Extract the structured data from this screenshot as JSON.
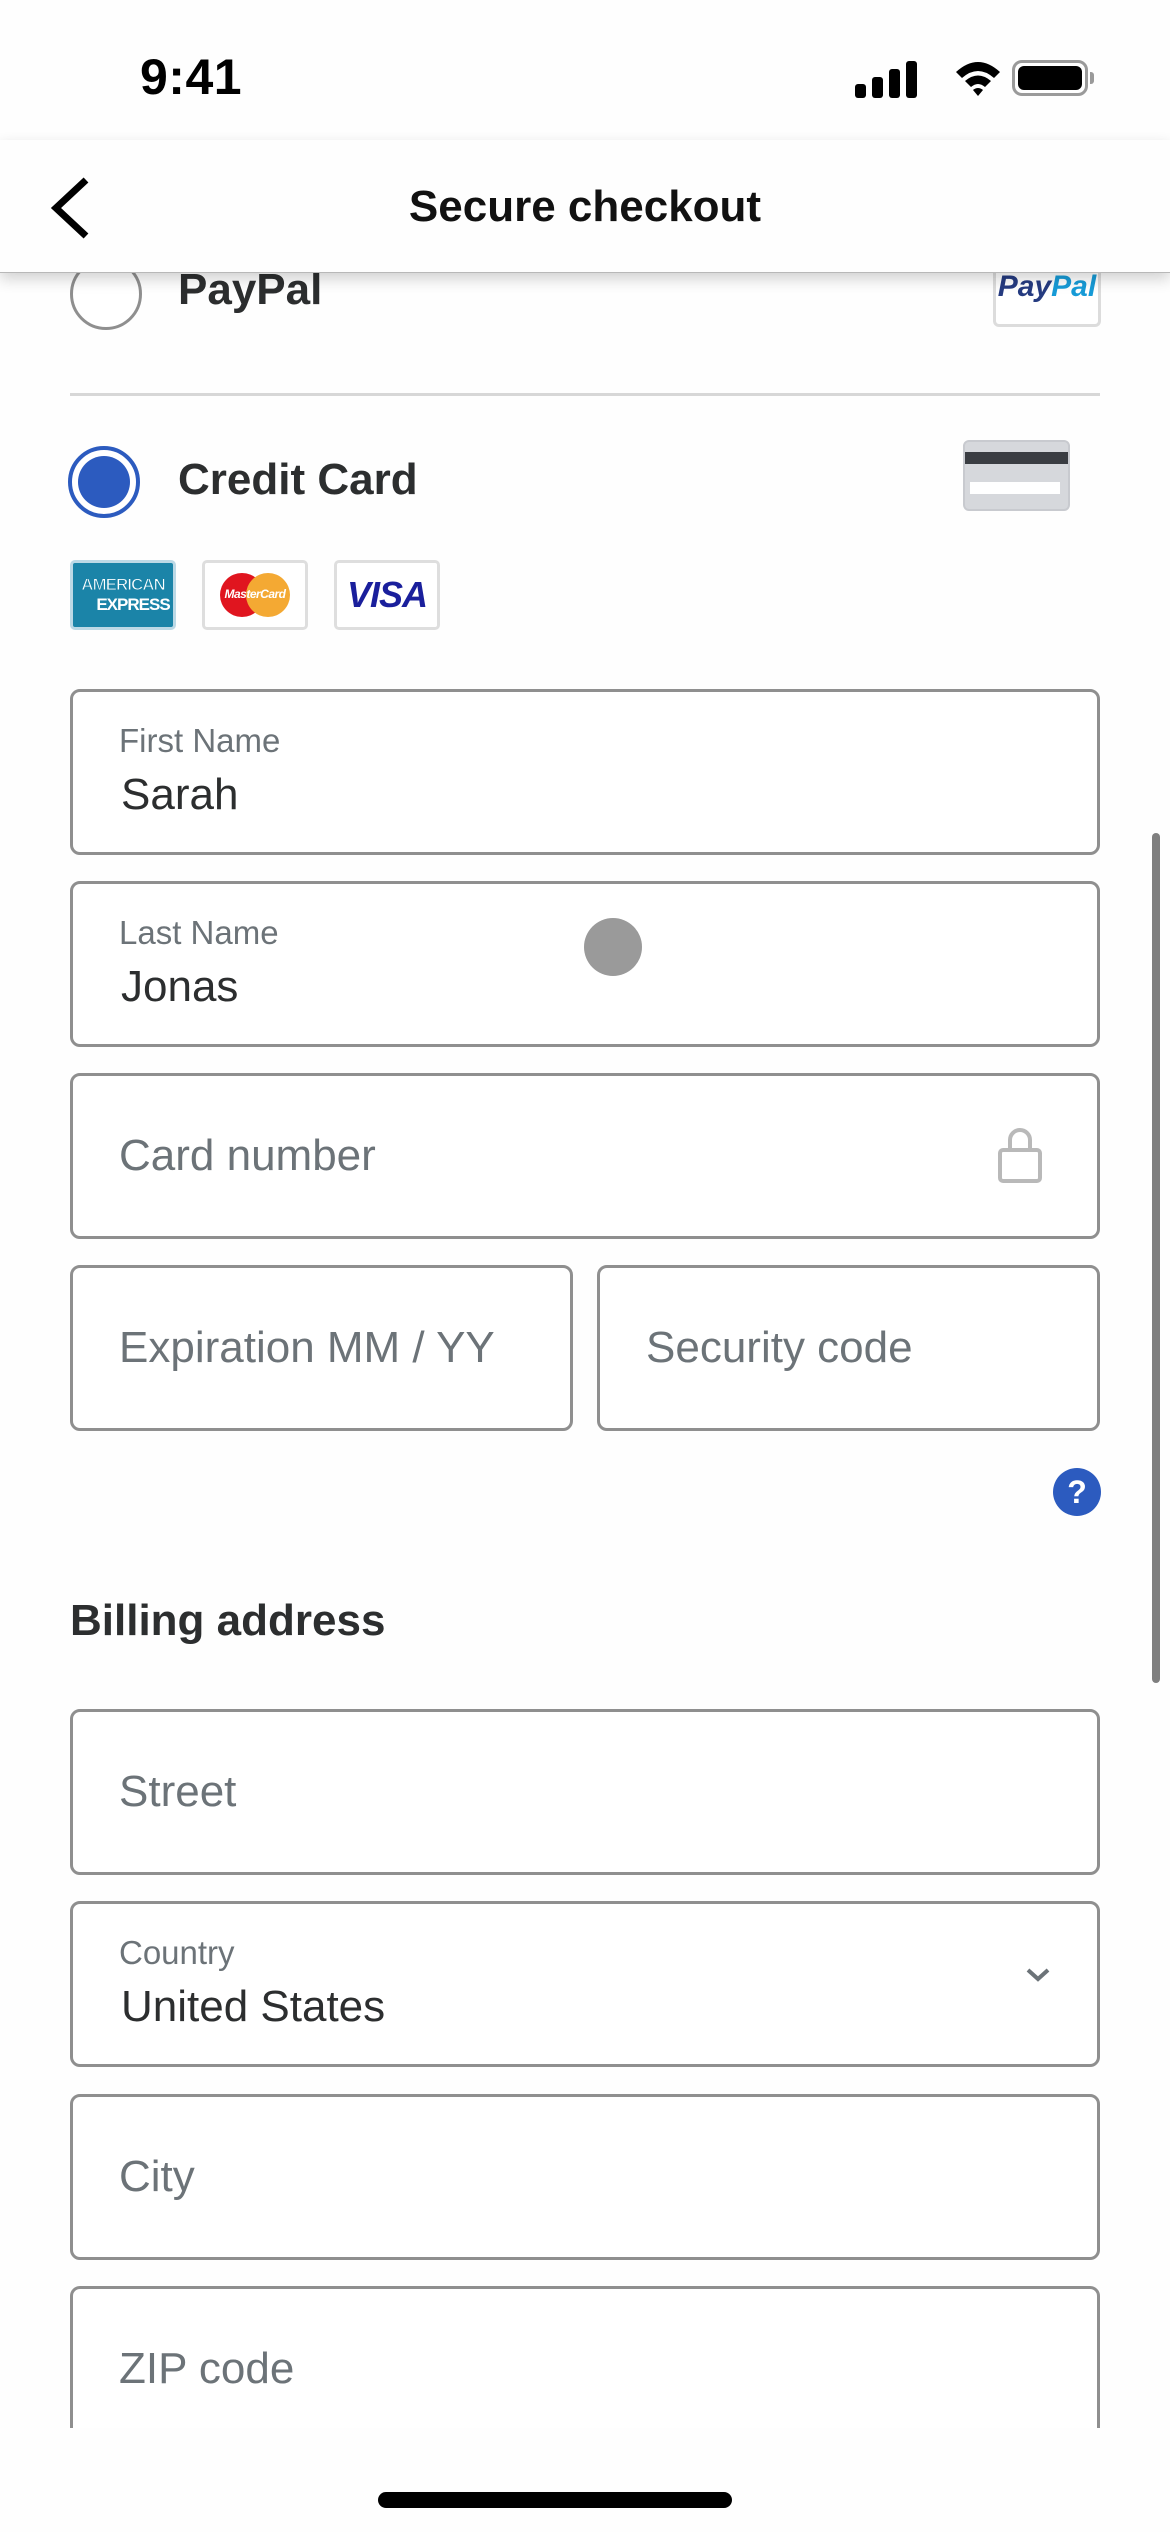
{
  "status_bar": {
    "time": "9:41",
    "icons": [
      "cellular-signal-icon",
      "wifi-icon",
      "battery-icon"
    ]
  },
  "nav": {
    "back_icon": "chevron-left-icon",
    "title": "Secure checkout"
  },
  "payment_methods": [
    {
      "label": "PayPal",
      "selected": false,
      "logo": {
        "part1": "Pay",
        "part2": "Pal"
      }
    },
    {
      "label": "Credit Card",
      "selected": true,
      "logo": "credit-card-icon"
    }
  ],
  "card_brands": {
    "amex": {
      "line1": "AMERICAN",
      "line2": "EXPRESS"
    },
    "mastercard": {
      "text": "MasterCard"
    },
    "visa": {
      "text": "VISA"
    }
  },
  "card_form": {
    "first_name": {
      "label": "First Name",
      "value": "Sarah"
    },
    "last_name": {
      "label": "Last Name",
      "value": "Jonas"
    },
    "card_number": {
      "placeholder": "Card number",
      "icon": "lock-icon"
    },
    "expiration": {
      "placeholder": "Expiration MM / YY"
    },
    "security_code": {
      "placeholder": "Security code"
    },
    "help": {
      "glyph": "?"
    }
  },
  "billing": {
    "title": "Billing address",
    "street": {
      "placeholder": "Street"
    },
    "country": {
      "label": "Country",
      "value": "United States"
    },
    "city": {
      "placeholder": "City"
    },
    "zip": {
      "placeholder": "ZIP code"
    }
  },
  "colors": {
    "accent": "#2c5bbf",
    "field_border": "#8f8f8f",
    "text_primary": "#2c2e2f",
    "text_secondary": "#6c7378"
  }
}
